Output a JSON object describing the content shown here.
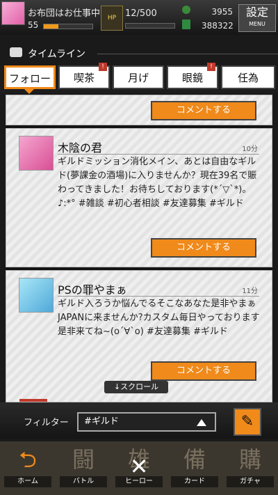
{
  "header": {
    "player_name": "お布団はお仕事中",
    "level": "55",
    "stamina": "12/500",
    "stamina_icon_label": "HP",
    "coins": "3955",
    "gems": "388322",
    "settings_label": "設定",
    "menu_label": "MENU"
  },
  "timeline": {
    "title": "タイムライン"
  },
  "tabs": [
    {
      "label": "フォロー",
      "active": true,
      "badge": ""
    },
    {
      "label": "喫茶",
      "active": false,
      "badge": "!"
    },
    {
      "label": "月げ",
      "active": false,
      "badge": ""
    },
    {
      "label": "眼鏡",
      "active": false,
      "badge": "!"
    },
    {
      "label": "任為",
      "active": false,
      "badge": ""
    }
  ],
  "comment_button": "コメントする",
  "posts": [
    {
      "name": "木陰の君",
      "time": "10分",
      "text": "ギルドミッション消化メイン、あとは自由なギルド(夢課金の酒場)に入りませんか？現在39名で賑わってきました！お待ちしております(*´▽`*)。♪:*°  #雑談 #初心者相談 #友達募集 #ギルド"
    },
    {
      "name": "PSの罪やまぁ",
      "time": "11分",
      "text": "ギルド入ろうか悩んでるそこなあなた是非やまぁJAPANに来ませんか?カスタム毎日やっております是非来てね~(ο´∀`ο)  #友達募集 #ギルド"
    }
  ],
  "scroll_hint": "↓スクロール",
  "filter": {
    "label": "フィルター",
    "value": "#ギルド"
  },
  "nav": [
    {
      "icon": "⮌",
      "label": "ホーム"
    },
    {
      "icon": "闘",
      "label": "バトル"
    },
    {
      "icon": "雄",
      "label": "ヒーロー"
    },
    {
      "icon": "備",
      "label": "カード"
    },
    {
      "icon": "購",
      "label": "ガチャ"
    }
  ],
  "close_icon": "✕",
  "edit_icon": "✎",
  "colors": {
    "accent": "#f08a1a",
    "badge": "#c0392b"
  }
}
